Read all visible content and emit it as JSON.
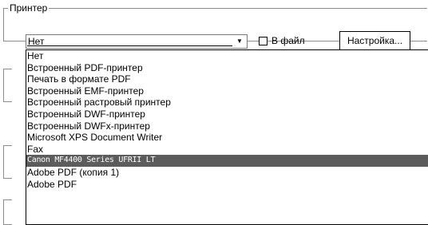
{
  "printer_group": {
    "title": "Принтер",
    "combo_value": "Нет",
    "print_to_file_label": "В файл",
    "settings_button_label": "Настройка..."
  },
  "printer_list": {
    "options": [
      "Нет",
      "Встроенный PDF-принтер",
      "Печать в формате PDF",
      "Встроенный EMF-принтер",
      "Встроенный растровый принтер",
      "Встроенный DWF-принтер",
      "Встроенный DWFx-принтер",
      "Microsoft XPS Document Writer",
      "Fax",
      "Canon MF4400 Series UFRII LT",
      "Adobe PDF (копия 1)",
      "Adobe PDF"
    ],
    "selected_index": 9
  }
}
